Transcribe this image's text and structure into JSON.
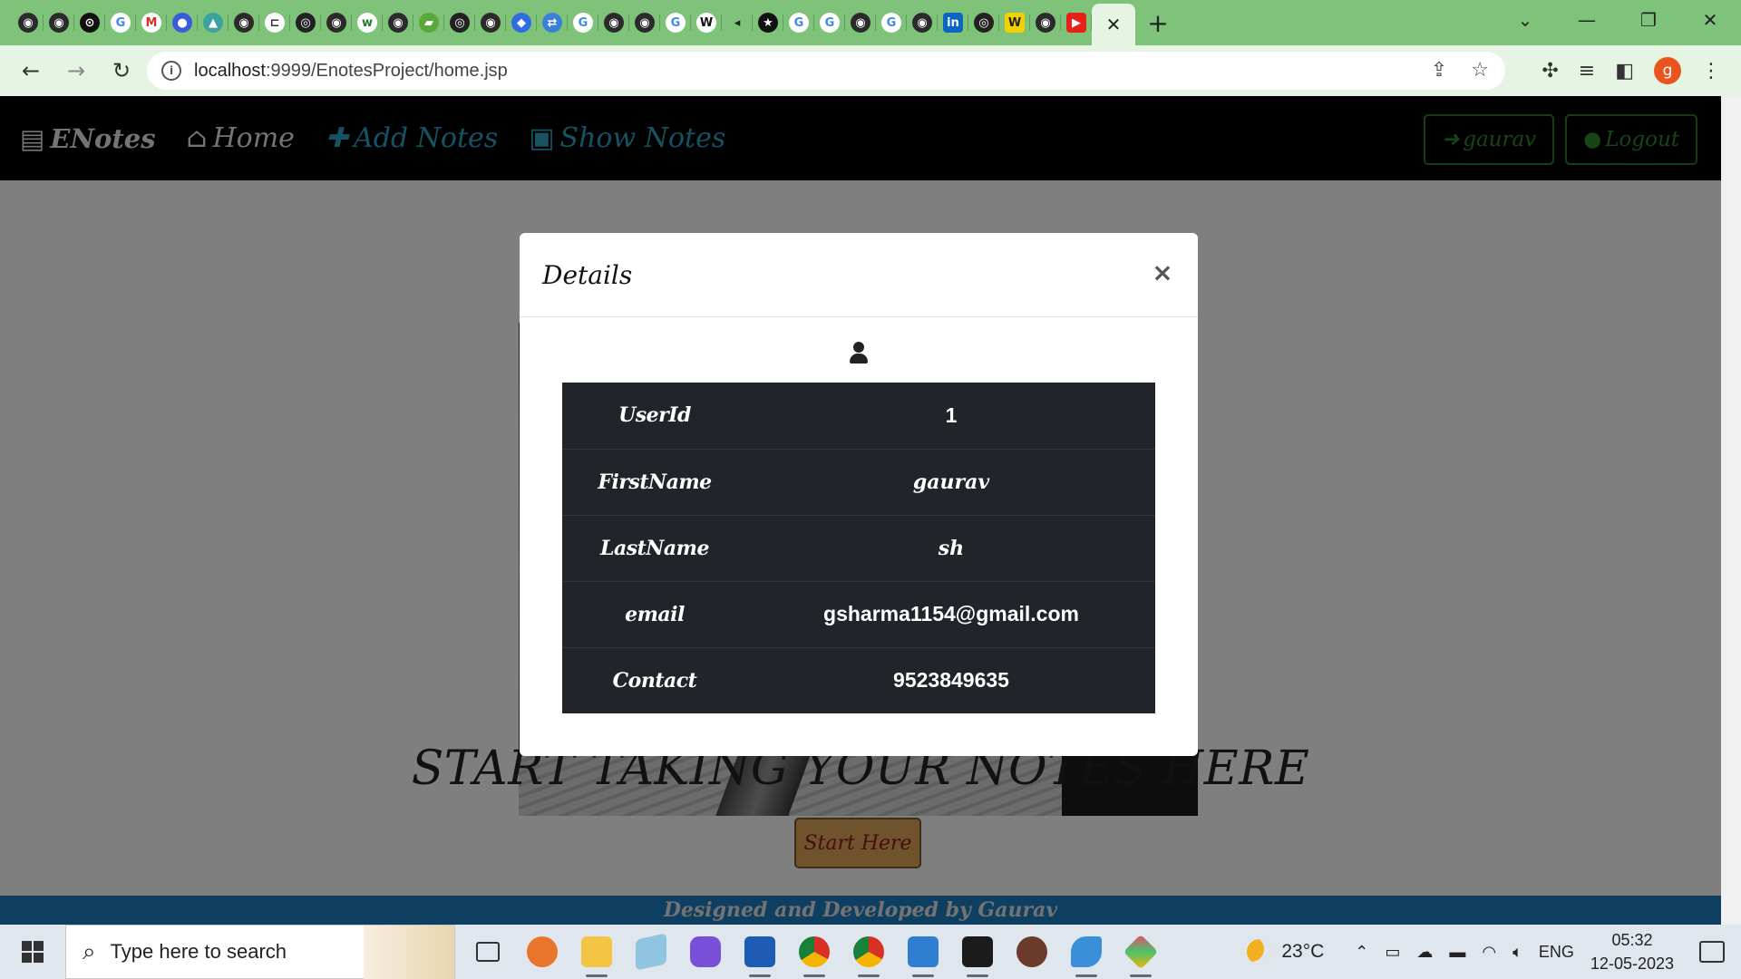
{
  "browser": {
    "tab_close": "✕",
    "new_tab": "+",
    "url_host": "localhost",
    "url_path": ":9999/EnotesProject/home.jsp",
    "profile_initial": "g",
    "tab_favicons": [
      "globe",
      "globe",
      "github-alt",
      "google",
      "gmail",
      "blue-app",
      "triangle",
      "globe",
      "bracket",
      "github",
      "globe",
      "word-w",
      "globe",
      "leaf",
      "github",
      "globe",
      "diamond",
      "translate",
      "google",
      "globe",
      "globe",
      "google",
      "wikipedia-w",
      "speaker",
      "star",
      "google",
      "google",
      "globe",
      "google",
      "globe",
      "linkedin",
      "github",
      "w-yellow",
      "globe",
      "youtube"
    ],
    "tab_favicon_labels": [
      "◉",
      "◉",
      "⊙",
      "G",
      "M",
      "●",
      "▲",
      "◉",
      "⊏",
      "◎",
      "◉",
      "w",
      "◉",
      "▰",
      "◎",
      "◉",
      "◆",
      "⇄",
      "G",
      "◉",
      "◉",
      "G",
      "W",
      "◂",
      "★",
      "G",
      "G",
      "◉",
      "G",
      "◉",
      "in",
      "◎",
      "W",
      "◉",
      "▶"
    ]
  },
  "navbar": {
    "brand": "ENotes",
    "home": "Home",
    "add_notes": "Add Notes",
    "show_notes": "Show Notes",
    "user_button": "gaurav",
    "logout_button": "Logout"
  },
  "page": {
    "headline": "START TAKING YOUR NOTES HERE",
    "start_button": "Start Here",
    "footer": "Designed and Developed by Gaurav"
  },
  "modal": {
    "title": "Details",
    "close": "×",
    "rows": [
      {
        "key": "UserId",
        "value": "1"
      },
      {
        "key": "FirstName",
        "value": "gaurav"
      },
      {
        "key": "LastName",
        "value": "sh"
      },
      {
        "key": "email",
        "value": "gsharma1154@gmail.com"
      },
      {
        "key": "Contact",
        "value": "9523849635"
      }
    ]
  },
  "taskbar": {
    "search_placeholder": "Type here to search",
    "temperature": "23°C",
    "language": "ENG",
    "time": "05:32",
    "date": "12-05-2023",
    "apps": [
      "task-view",
      "discord",
      "file-explorer",
      "notepad",
      "copilot",
      "word",
      "chrome",
      "chrome-profile",
      "photos",
      "terminal",
      "game",
      "vscode-like",
      "git-app"
    ]
  },
  "colors": {
    "tabstrip": "#7fc27a",
    "toolbar": "#e6f4e4",
    "nav_accent": "#2ea4c6",
    "footer": "#1e7fc0",
    "table_bg": "#212529",
    "start_button": "#e0a75a"
  }
}
